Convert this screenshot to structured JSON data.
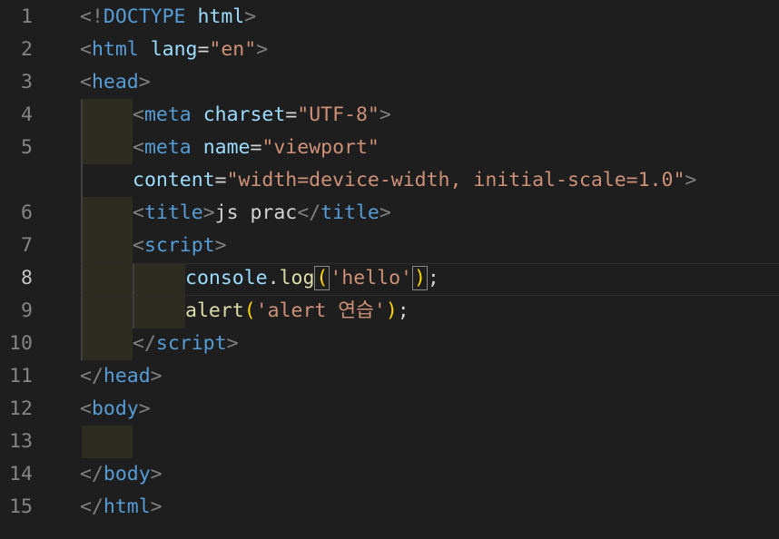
{
  "line_numbers": [
    "1",
    "2",
    "3",
    "4",
    "5",
    "6",
    "7",
    "8",
    "9",
    "10",
    "11",
    "12",
    "13",
    "14",
    "15"
  ],
  "active_line": "8",
  "code": {
    "l1": {
      "open": "<!",
      "doctype": "DOCTYPE",
      "html": "html",
      "close": ">"
    },
    "l2": {
      "open": "<",
      "tag": "html",
      "attr": "lang",
      "eq": "=",
      "val": "\"en\"",
      "close": ">"
    },
    "l3": {
      "open": "<",
      "tag": "head",
      "close": ">"
    },
    "l4": {
      "open": "<",
      "tag": "meta",
      "attr": "charset",
      "eq": "=",
      "val": "\"UTF-8\"",
      "close": ">"
    },
    "l5": {
      "open": "<",
      "tag": "meta",
      "attr": "name",
      "eq": "=",
      "val": "\"viewport\""
    },
    "l5b": {
      "attr": "content",
      "eq": "=",
      "val": "\"width=device-width, initial-scale=1.0\"",
      "close": ">"
    },
    "l6": {
      "open": "<",
      "tag": "title",
      "close": ">",
      "text": "js prac",
      "open2": "</",
      "tag2": "title",
      "close2": ">"
    },
    "l7": {
      "open": "<",
      "tag": "script",
      "close": ">"
    },
    "l8": {
      "obj": "console",
      "dot": ".",
      "fn": "log",
      "lp": "(",
      "str": "'hello'",
      "rp": ")",
      "semi": ";"
    },
    "l9": {
      "fn": "alert",
      "lp": "(",
      "str": "'alert 연습'",
      "rp": ")",
      "semi": ";"
    },
    "l10": {
      "open": "</",
      "tag": "script",
      "close": ">"
    },
    "l11": {
      "open": "</",
      "tag": "head",
      "close": ">"
    },
    "l12": {
      "open": "<",
      "tag": "body",
      "close": ">"
    },
    "l14": {
      "open": "</",
      "tag": "body",
      "close": ">"
    },
    "l15": {
      "open": "</",
      "tag": "html",
      "close": ">"
    }
  }
}
